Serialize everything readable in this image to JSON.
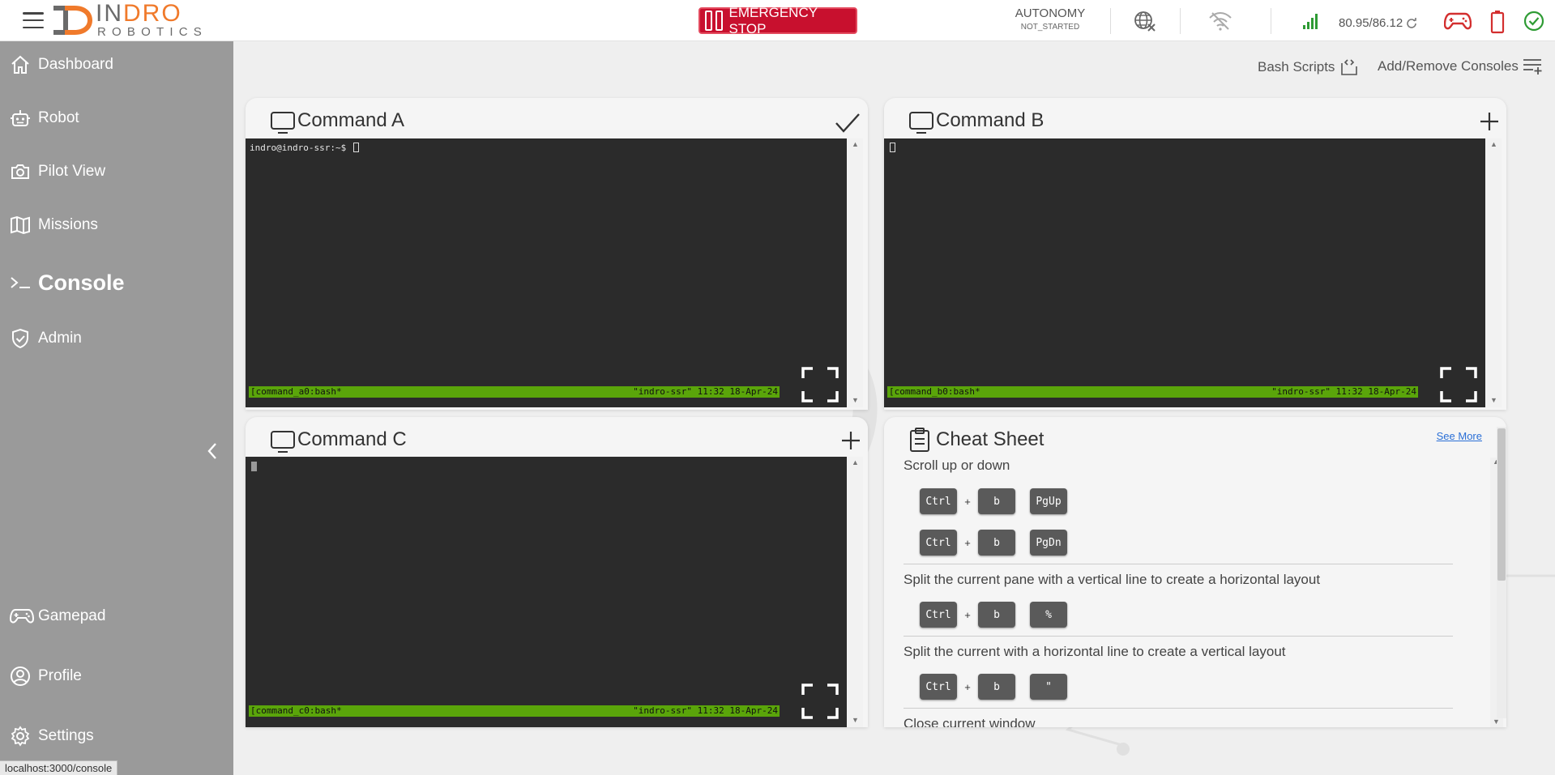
{
  "topbar": {
    "logo_top": "INDRO",
    "logo_top_first": "IN",
    "logo_top_rest": "DRO",
    "logo_bottom": "ROBOTICS",
    "emergency_stop_label": "EMERGENCY STOP",
    "autonomy_label": "AUTONOMY",
    "autonomy_status": "NOT_STARTED",
    "battery_text": "80.95/86.12",
    "colors": {
      "estop": "#c8102e",
      "accent": "#f07a2b",
      "ok": "#2e9b34",
      "alert": "#d32f2f"
    }
  },
  "sidebar": {
    "items": [
      {
        "label": "Dashboard",
        "icon": "home-icon"
      },
      {
        "label": "Robot",
        "icon": "robot-icon"
      },
      {
        "label": "Pilot View",
        "icon": "camera-icon"
      },
      {
        "label": "Missions",
        "icon": "map-icon"
      },
      {
        "label": "Console",
        "icon": "terminal-prompt-icon",
        "active": true
      },
      {
        "label": "Admin",
        "icon": "shield-check-icon"
      }
    ],
    "bottom_items": [
      {
        "label": "Gamepad",
        "icon": "gamepad-icon"
      },
      {
        "label": "Profile",
        "icon": "user-circle-icon"
      },
      {
        "label": "Settings",
        "icon": "gear-icon"
      }
    ],
    "status_url": "localhost:3000/console"
  },
  "toolbar": {
    "bash_scripts_label": "Bash Scripts",
    "add_remove_label": "Add/Remove Consoles"
  },
  "consoles": [
    {
      "title": "Command A",
      "prompt": "indro@indro-ssr:~$",
      "status_left": "[command_a0:bash*",
      "status_right": "\"indro-ssr\" 11:32 18-Apr-24",
      "action": "check-icon"
    },
    {
      "title": "Command B",
      "prompt": "",
      "status_left": "[command_b0:bash*",
      "status_right": "\"indro-ssr\" 11:32 18-Apr-24",
      "action": "plus-icon"
    },
    {
      "title": "Command C",
      "prompt": "",
      "status_left": "[command_c0:bash*",
      "status_right": "\"indro-ssr\" 11:32 18-Apr-24",
      "action": "plus-icon"
    }
  ],
  "cheat_sheet": {
    "title": "Cheat Sheet",
    "see_more": "See More",
    "sections": [
      {
        "title": "Scroll up or down",
        "rows": [
          [
            "Ctrl",
            "b",
            "PgUp"
          ],
          [
            "Ctrl",
            "b",
            "PgDn"
          ]
        ]
      },
      {
        "title": "Split the current pane with a vertical line to create a horizontal layout",
        "rows": [
          [
            "Ctrl",
            "b",
            "%"
          ]
        ]
      },
      {
        "title": "Split the current with a horizontal line to create a vertical layout",
        "rows": [
          [
            "Ctrl",
            "b",
            "\""
          ]
        ]
      },
      {
        "title": "Close current window",
        "rows": []
      }
    ],
    "plus": "+"
  }
}
